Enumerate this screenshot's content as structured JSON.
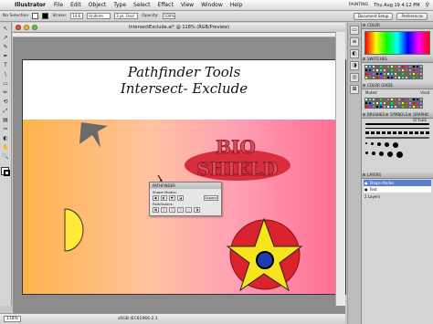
{
  "menubar": {
    "app": "Illustrator",
    "menus": [
      "File",
      "Edit",
      "Object",
      "Type",
      "Select",
      "Effect",
      "View",
      "Window",
      "Help"
    ],
    "workspace": "PAINTING",
    "clock": "Thu Aug 19  4:12 PM"
  },
  "control": {
    "selection": "No Selection",
    "stroke_label": "Stroke:",
    "stroke_value": "14.6",
    "style_value": "Uniform",
    "profile_value": "3 pt. Oval",
    "opacity_label": "Opacity:",
    "opacity_value": "100%",
    "doc_setup": "Document Setup",
    "preferences": "Preferences"
  },
  "document": {
    "tab": "IntersectExclude.ai* @ 118% (RGB/Preview)",
    "line1": "Pathfinder Tools",
    "line2": "Intersect- Exclude",
    "banner_top": "BIO",
    "banner_bottom": "SHIELD",
    "zoom": "118%",
    "status": "sRGB IEC61966-2.1"
  },
  "pathfinder": {
    "title": "PATHFINDER",
    "shape_modes": "Shape Modes:",
    "pathfinders": "Pathfinders:",
    "expand": "Expand"
  },
  "panels": {
    "color": "COLOR",
    "swatches": "SWATCHES",
    "color_guide": "COLOR GUIDE",
    "muted": "Muted",
    "vivid": "Vivid",
    "brushes": "BRUSHES",
    "symbols": "SYMBOLS",
    "graphic_styles": "GRAPHIC STYLES",
    "layers": "LAYERS",
    "layer1": "Shape Modes",
    "layer2": "Text",
    "layer_count": "2 Layers"
  },
  "colors": {
    "star": "#f6e51e",
    "circle": "#d9222b",
    "dot": "#1e3eb0",
    "half": "#ffea3a",
    "banner": "#d72d3d",
    "arrow": "#6a6a6a"
  },
  "tools": [
    "↖",
    "↗",
    "✎",
    "✒",
    "T",
    "\\",
    "▭",
    "✏",
    "⟲",
    "⤢",
    "▤",
    "✂",
    "◐",
    "✋",
    "🔍"
  ]
}
